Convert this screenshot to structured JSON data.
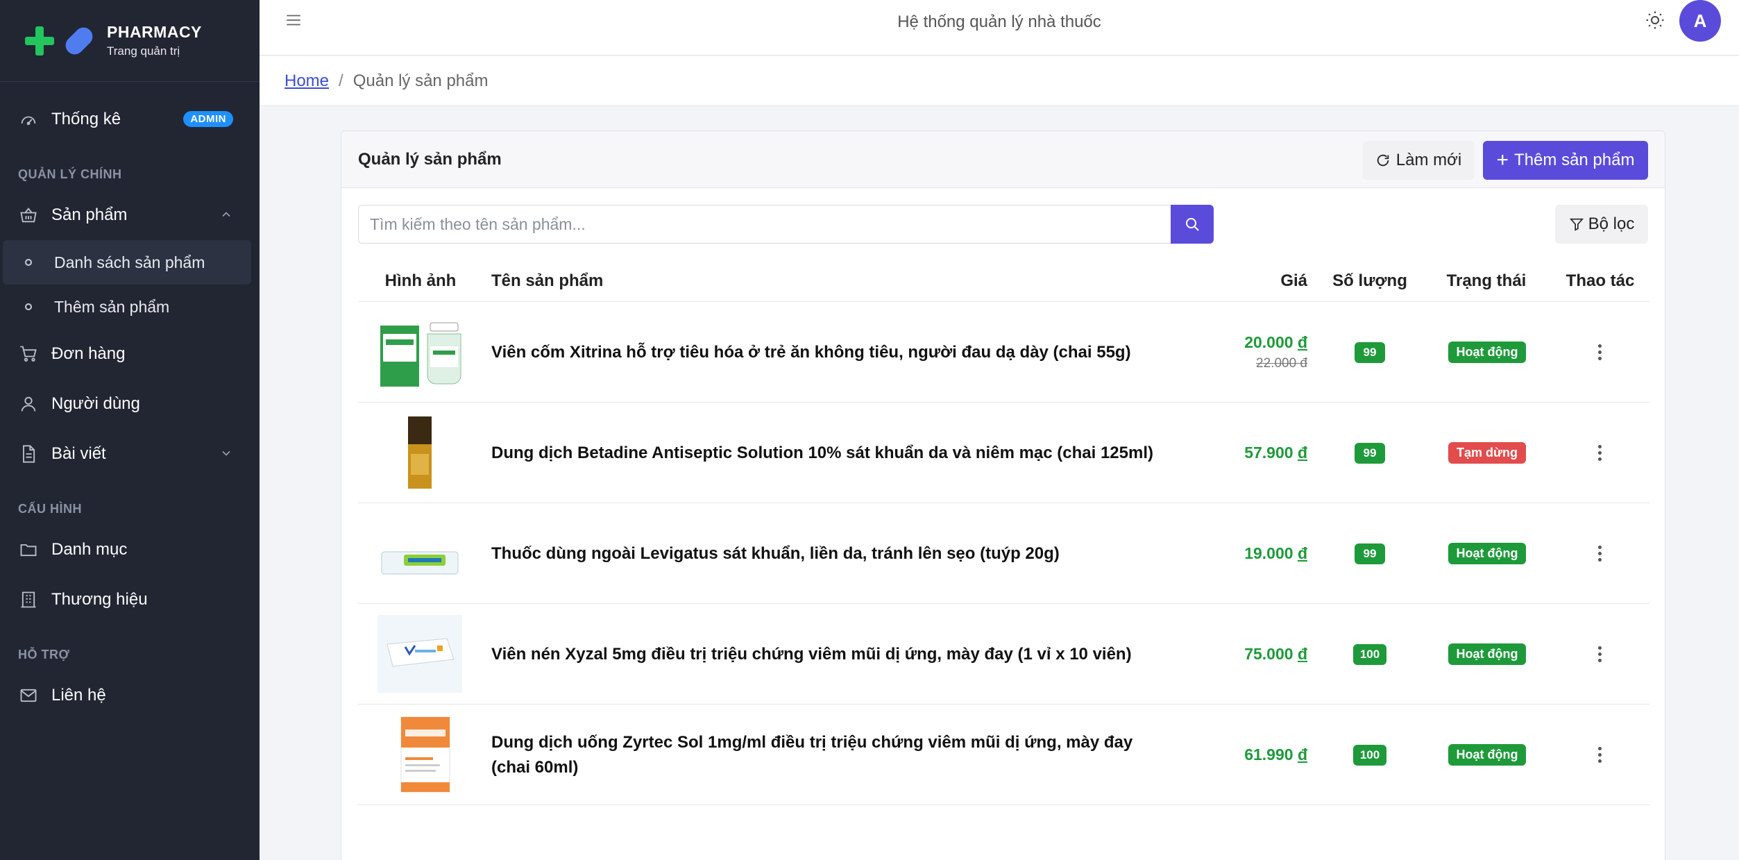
{
  "brand": {
    "name": "PHARMACY",
    "subtitle": "Trang quản trị"
  },
  "sidebar": {
    "dashboard": {
      "label": "Thống kê",
      "badge": "ADMIN"
    },
    "section_main": "QUẢN LÝ CHÍNH",
    "products": {
      "label": "Sản phẩm",
      "children": [
        "Danh sách sản phẩm",
        "Thêm sản phẩm"
      ]
    },
    "orders": "Đơn hàng",
    "users": "Người dùng",
    "posts": "Bài viết",
    "section_config": "CẤU HÌNH",
    "categories": "Danh mục",
    "brands": "Thương hiệu",
    "section_support": "HỖ TRỢ",
    "contact": "Liên hệ"
  },
  "topbar": {
    "title": "Hệ thống quản lý nhà thuốc",
    "avatar_initial": "A"
  },
  "breadcrumb": {
    "home": "Home",
    "separator": "/",
    "current": "Quản lý sản phẩm"
  },
  "card": {
    "title": "Quản lý sản phẩm",
    "refresh_label": "Làm mới",
    "add_label": "Thêm sản phẩm",
    "search_placeholder": "Tìm kiếm theo tên sản phẩm...",
    "filter_label": "Bộ lọc"
  },
  "table": {
    "headers": {
      "image": "Hình ảnh",
      "name": "Tên sản phẩm",
      "price": "Giá",
      "qty": "Số lượng",
      "status": "Trạng thái",
      "actions": "Thao tác"
    },
    "currency": "đ",
    "rows": [
      {
        "name": "Viên cốm Xitrina hỗ trợ tiêu hóa ở trẻ ăn không tiêu, người đau dạ dày (chai 55g)",
        "price": "20.000",
        "old_price": "22.000 đ",
        "qty": "99",
        "status": "Hoạt động"
      },
      {
        "name": "Dung dịch Betadine Antiseptic Solution 10% sát khuẩn da và niêm mạc (chai 125ml)",
        "price": "57.900",
        "qty": "99",
        "status": "Tạm dừng"
      },
      {
        "name": "Thuốc dùng ngoài Levigatus sát khuẩn, liền da, tránh lên sẹo (tuýp 20g)",
        "price": "19.000",
        "qty": "99",
        "status": "Hoạt động"
      },
      {
        "name": "Viên nén Xyzal 5mg điều trị triệu chứng viêm mũi dị ứng, mày đay (1 vỉ x 10 viên)",
        "price": "75.000",
        "qty": "100",
        "status": "Hoạt động"
      },
      {
        "name": "Dung dịch uống Zyrtec Sol 1mg/ml điều trị triệu chứng viêm mũi dị ứng, mày đay (chai 60ml)",
        "price": "61.990",
        "qty": "100",
        "status": "Hoạt động"
      }
    ]
  },
  "colors": {
    "primary": "#5b4bdb",
    "sidebar_bg": "#222633",
    "success": "#1e9a3a",
    "danger": "#e24c4c",
    "brand_green": "#22c55e",
    "brand_blue": "#4f7df0"
  }
}
